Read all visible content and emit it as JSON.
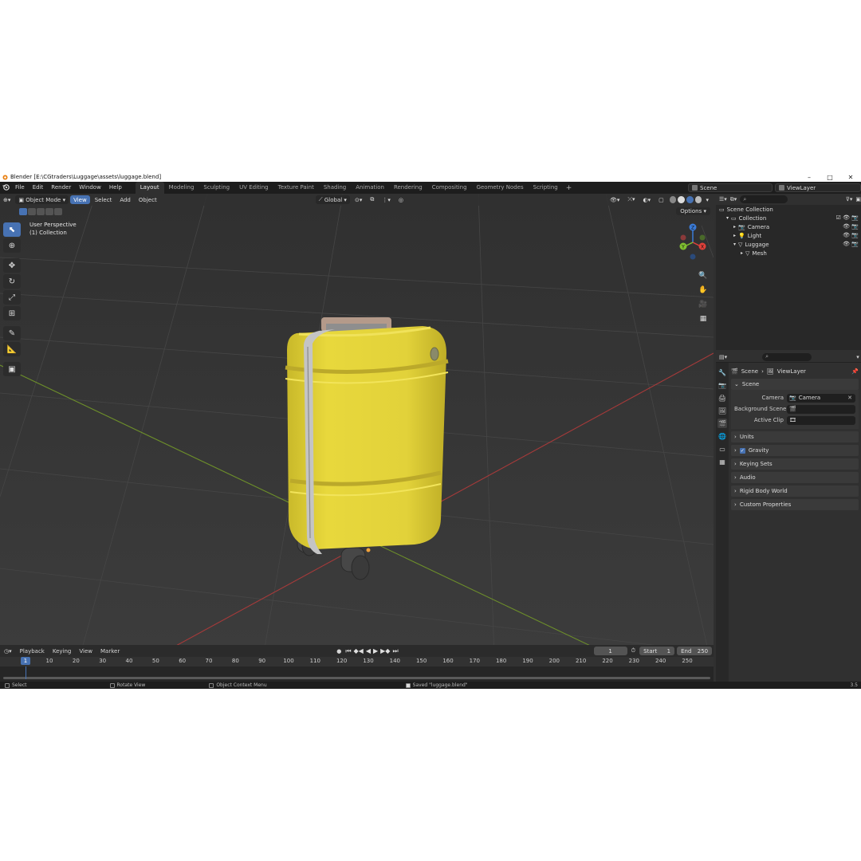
{
  "window": {
    "title": "Blender [E:\\CGtraders\\Luggage\\assets\\luggage.blend]",
    "controls": [
      "–",
      "□",
      "✕"
    ]
  },
  "topbar": {
    "menus": [
      "File",
      "Edit",
      "Render",
      "Window",
      "Help"
    ],
    "workspaces": [
      "Layout",
      "Modeling",
      "Sculpting",
      "UV Editing",
      "Texture Paint",
      "Shading",
      "Animation",
      "Rendering",
      "Compositing",
      "Geometry Nodes",
      "Scripting"
    ],
    "active_workspace": "Layout",
    "add_symbol": "+",
    "scene": "Scene",
    "view_layer": "ViewLayer"
  },
  "viewport": {
    "mode": "Object Mode",
    "menus": [
      "View",
      "Select",
      "Add",
      "Object"
    ],
    "active_menu": "View",
    "transform_orientation": "Global",
    "options": "Options",
    "info_line1": "User Perspective",
    "info_line2": "(1) Collection"
  },
  "gizmo": {
    "x_color": "#e0403a",
    "y_color": "#7fbf30",
    "z_color": "#3a7bd8",
    "labels": [
      "X",
      "Y",
      "Z"
    ]
  },
  "outliner": {
    "rows": [
      {
        "label": "Scene Collection",
        "icon": "scene-collection-icon",
        "indent": 0
      },
      {
        "label": "Collection",
        "icon": "collection-icon",
        "indent": 1
      },
      {
        "label": "Camera",
        "icon": "camera-icon",
        "indent": 2
      },
      {
        "label": "Light",
        "icon": "light-icon",
        "indent": 2
      },
      {
        "label": "Luggage",
        "icon": "mesh-object-icon",
        "indent": 2
      },
      {
        "label": "Mesh",
        "icon": "mesh-data-icon",
        "indent": 3
      }
    ]
  },
  "properties": {
    "breadcrumb_scene": "Scene",
    "breadcrumb_layer": "ViewLayer",
    "panel_scene": "Scene",
    "camera_label": "Camera",
    "camera_value": "Camera",
    "background_scene_label": "Background Scene",
    "active_clip_label": "Active Clip",
    "panels": [
      "Units",
      "Gravity",
      "Keying Sets",
      "Audio",
      "Rigid Body World",
      "Custom Properties"
    ]
  },
  "timeline": {
    "menus": [
      "Playback",
      "Keying",
      "View",
      "Marker"
    ],
    "current_frame": "1",
    "start_label": "Start",
    "start": "1",
    "end_label": "End",
    "end": "250",
    "ticks": [
      "1",
      "10",
      "20",
      "30",
      "40",
      "50",
      "60",
      "70",
      "80",
      "90",
      "100",
      "110",
      "120",
      "130",
      "140",
      "150",
      "160",
      "170",
      "180",
      "190",
      "200",
      "210",
      "220",
      "230",
      "240",
      "250"
    ]
  },
  "statusbar": {
    "select": "Select",
    "rotate": "Rotate View",
    "context": "Object Context Menu",
    "saved": "Saved \"luggage.blend\"",
    "version": "3.5"
  },
  "colors": {
    "accent": "#4772b3",
    "luggage_body": "#e6d63a",
    "strap": "#b8b8b8",
    "x_axis_line": "#a63a3a",
    "y_axis_line": "#6d8f2a"
  }
}
